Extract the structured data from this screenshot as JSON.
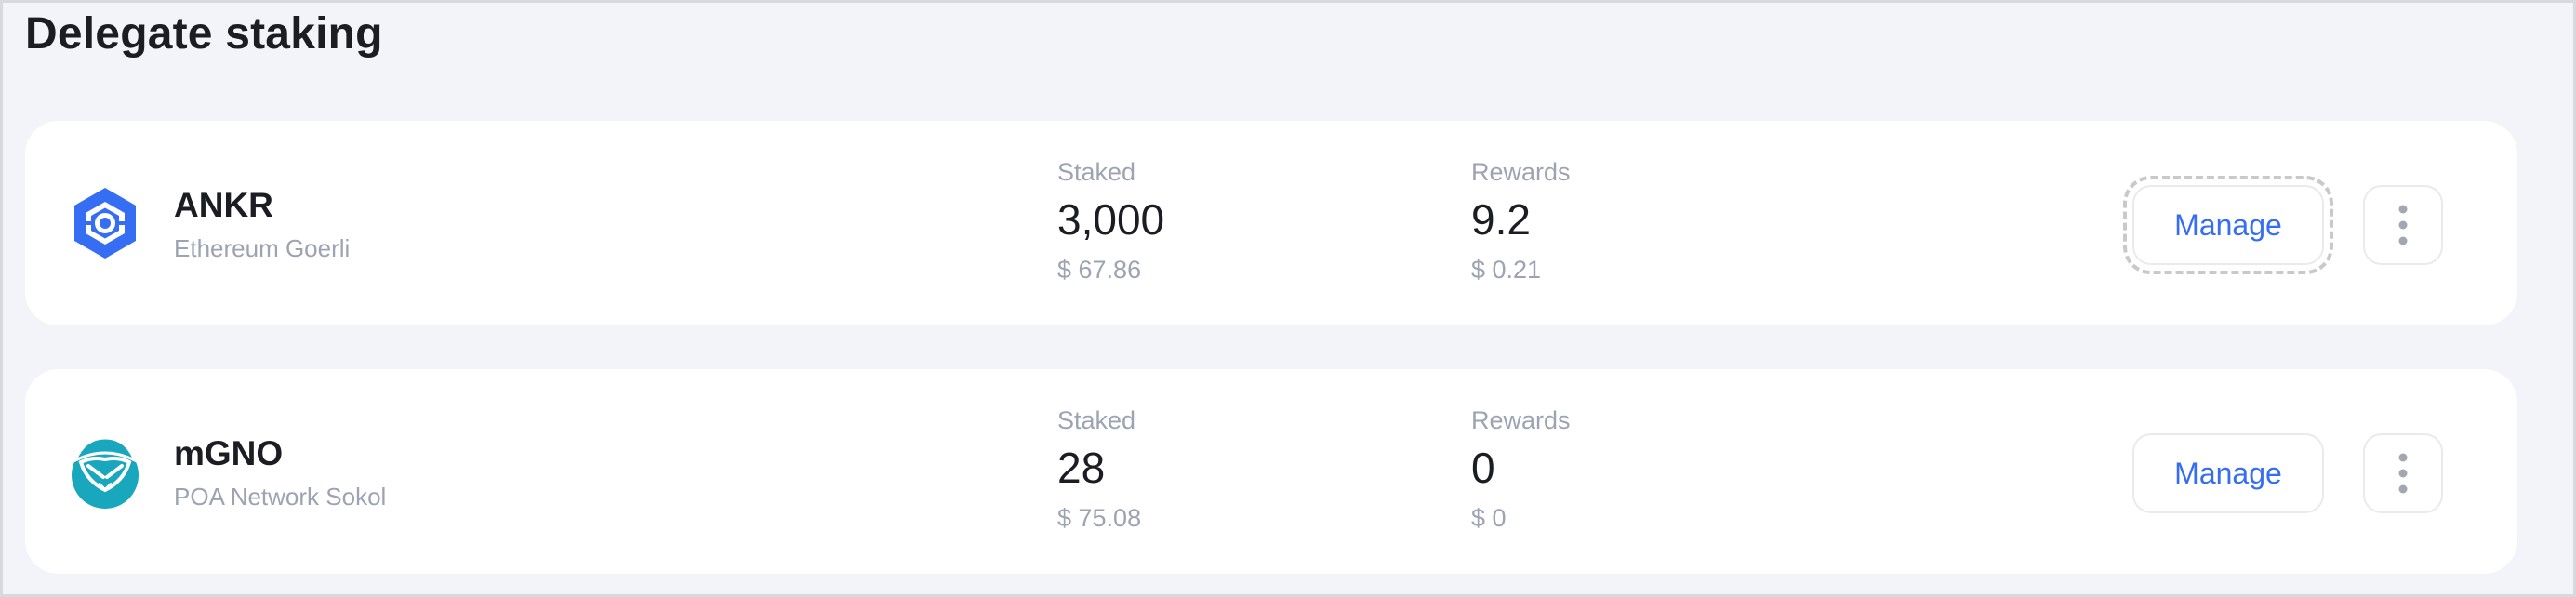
{
  "page": {
    "title": "Delegate staking"
  },
  "colors": {
    "accent": "#356df3",
    "ankr_brand": "#356df3",
    "gno_brand": "#19a7be",
    "muted_text": "#9da3b2"
  },
  "stakes": [
    {
      "token": "ANKR",
      "network": "Ethereum Goerli",
      "icon": "ankr-logo-icon",
      "staked_label": "Staked",
      "staked_value": "3,000",
      "staked_usd": "$ 67.86",
      "rewards_label": "Rewards",
      "rewards_value": "9.2",
      "rewards_usd": "$ 0.21",
      "manage_label": "Manage",
      "more_icon": "vertical-dots-icon"
    },
    {
      "token": "mGNO",
      "network": "POA Network Sokol",
      "icon": "mgno-logo-icon",
      "staked_label": "Staked",
      "staked_value": "28",
      "staked_usd": "$ 75.08",
      "rewards_label": "Rewards",
      "rewards_value": "0",
      "rewards_usd": "$ 0",
      "manage_label": "Manage",
      "more_icon": "vertical-dots-icon"
    }
  ]
}
